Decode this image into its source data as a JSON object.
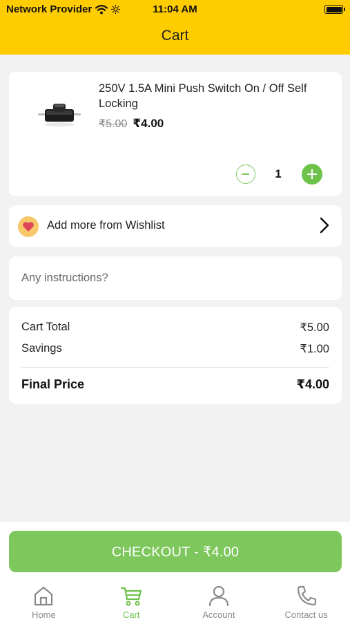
{
  "status_bar": {
    "carrier": "Network Provider",
    "time": "11:04 AM",
    "wifi_icon": "wifi-icon",
    "brightness_icon": "brightness-icon",
    "battery_icon": "battery-full-icon"
  },
  "header": {
    "title": "Cart",
    "background_color": "#ffcc00"
  },
  "cart_item": {
    "name": "250V 1.5A Mini Push Switch On / Off Self Locking",
    "image_icon": "push-switch-product-image",
    "original_price": "₹5.00",
    "price": "₹4.00",
    "quantity": "1",
    "minus_icon": "minus-circle-icon",
    "plus_icon": "plus-circle-icon"
  },
  "wishlist": {
    "label": "Add more from Wishlist",
    "icon": "heart-icon",
    "chevron_icon": "chevron-right-icon"
  },
  "instructions": {
    "placeholder": "Any instructions?",
    "value": ""
  },
  "summary": {
    "cart_total_label": "Cart Total",
    "cart_total_value": "₹5.00",
    "savings_label": "Savings",
    "savings_value": "₹1.00",
    "final_price_label": "Final Price",
    "final_price_value": "₹4.00"
  },
  "checkout": {
    "label": "CHECKOUT - ₹4.00",
    "color": "#7dc75c"
  },
  "tabs": [
    {
      "label": "Home",
      "icon": "home-icon",
      "active": false
    },
    {
      "label": "Cart",
      "icon": "cart-icon",
      "active": true
    },
    {
      "label": "Account",
      "icon": "account-icon",
      "active": false
    },
    {
      "label": "Contact us",
      "icon": "phone-icon",
      "active": false
    }
  ],
  "colors": {
    "accent_green": "#6cc24a",
    "inactive_gray": "#8a8a8a"
  }
}
